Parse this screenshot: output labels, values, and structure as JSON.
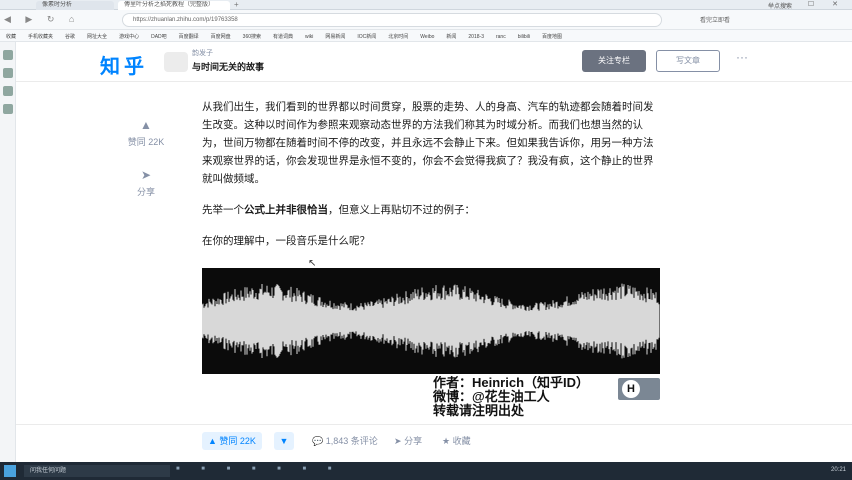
{
  "browser": {
    "tabs": [
      "像素时分析",
      "傅里叶分析之掐死教程（完整版）"
    ],
    "new_tab": "+",
    "url": "https://zhuanlan.zhihu.com/p/19763358",
    "window_controls": "— ☐ ✕",
    "controls_label": "举点搜索",
    "right_url_text": "看完立即看",
    "nav_icons": "◀ ▶ ↻ ⌂",
    "bookmarks": [
      "收藏",
      "手机收藏夹",
      "谷歌",
      "网址大全",
      "游戏中心",
      "DAD吧",
      "百度翻译",
      "百度网盘",
      "360搜索",
      "有道词典",
      "wiki",
      "网易新闻",
      "IOC新闻",
      "北京时间",
      "Weibo",
      "新闻",
      "2018-3",
      "ranc",
      "bilibili",
      "百度地图"
    ]
  },
  "header": {
    "logo": "知乎",
    "column_author": "韵发子",
    "column_title": "与时间无关的故事",
    "follow_label": "关注专栏",
    "write_label": "写文章",
    "more": "···"
  },
  "side_actions": {
    "upvote_icon": "upvote-icon",
    "upvote_label": "赞同 22K",
    "share_label": "分享"
  },
  "article": {
    "p1": "从我们出生，我们看到的世界都以时间贯穿，股票的走势、人的身高、汽车的轨迹都会随着时间发生改变。这种以时间作为参照来观察动态世界的方法我们称其为时域分析。而我们也想当然的认为，世间万物都在随着时间不停的改变，并且永远不会静止下来。但如果我告诉你，用另一种方法来观察世界的话，你会发现世界是永恒不变的，你会不会觉得我疯了？我没有疯，这个静止的世界就叫做频域。",
    "p2_pre": "先举一个",
    "p2_bold": "公式上并非很恰当",
    "p2_post": "，但意义上再贴切不过的例子：",
    "p3": "在你的理解中，一段音乐是什么呢？"
  },
  "watermark": {
    "line1": "作者：Heinrich（知乎ID）",
    "line2": "微博：@花生油工人",
    "line3": "转载请注明出处",
    "badge": "H"
  },
  "bottom_bar": {
    "upvote_label": "▲ 赞同 22K",
    "downvote_label": "▼",
    "comments_label": "1,843 条评论",
    "share_label": "分享",
    "favorite_label": "收藏"
  },
  "taskbar": {
    "search_placeholder": "问我任何问题",
    "clock": "20:21"
  },
  "colors": {
    "brand": "#0084ff",
    "muted": "#8590a6"
  }
}
